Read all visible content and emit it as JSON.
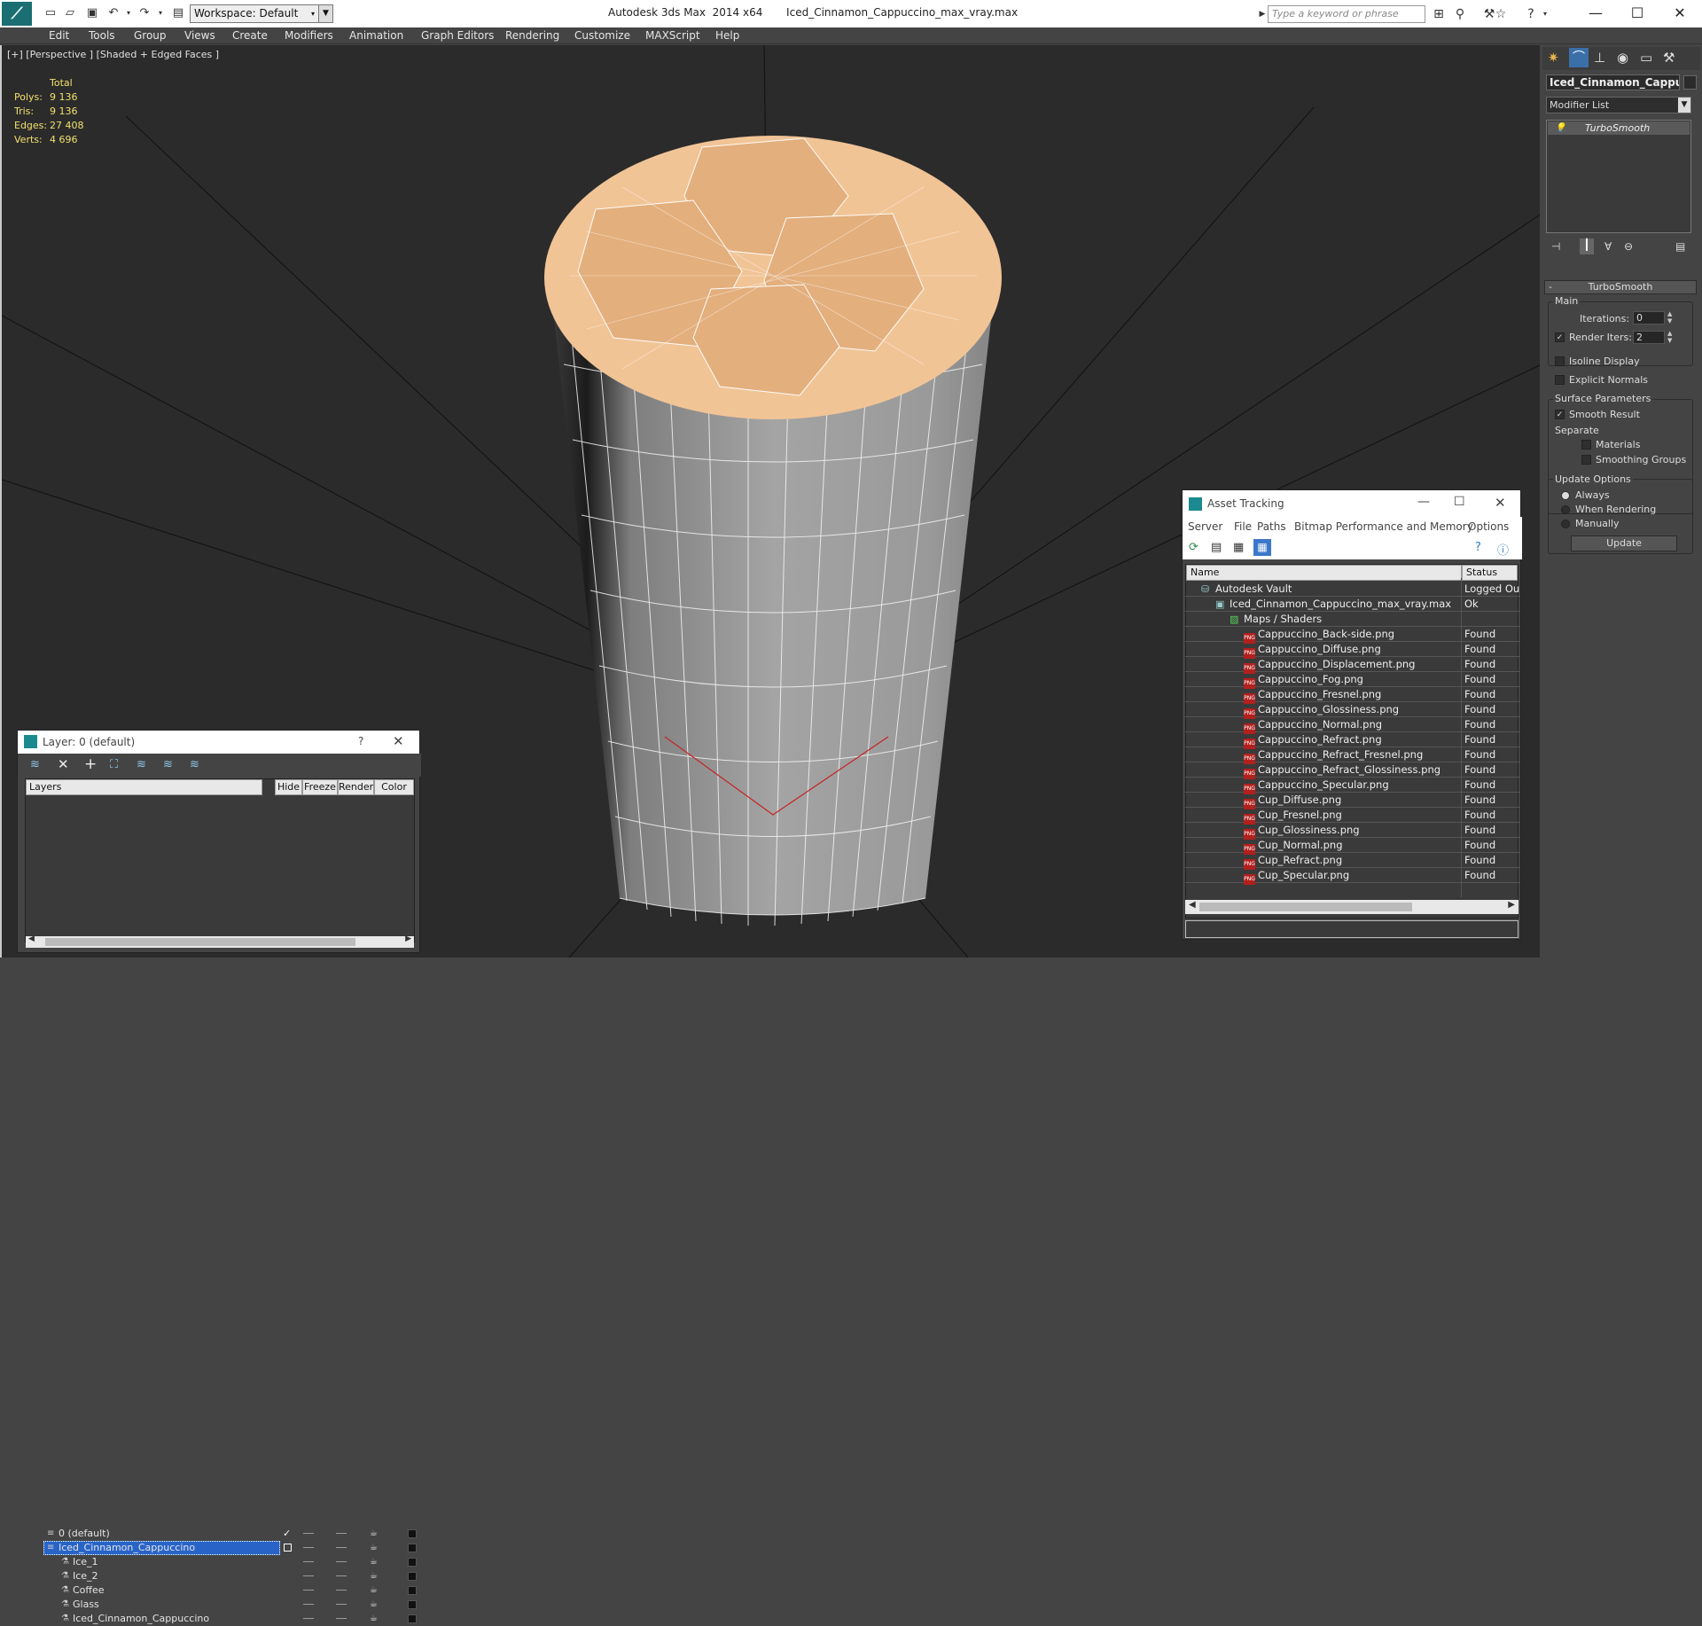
{
  "window": {
    "title": "Autodesk 3ds Max  2014 x64       Iced_Cinnamon_Cappuccino_max_vray.max",
    "workspace": "Workspace: Default",
    "search_placeholder": "Type a keyword or phrase"
  },
  "menu": [
    "Edit",
    "Tools",
    "Group",
    "Views",
    "Create",
    "Modifiers",
    "Animation",
    "Graph Editors",
    "Rendering",
    "Customize",
    "MAXScript",
    "Help"
  ],
  "viewport": {
    "label": "[+] [Perspective ] [Shaded + Edged Faces ]",
    "stats": {
      "header": "Total",
      "rows": [
        {
          "k": "Polys:",
          "v": "9 136"
        },
        {
          "k": "Tris:",
          "v": "9 136"
        },
        {
          "k": "Edges:",
          "v": "27 408"
        },
        {
          "k": "Verts:",
          "v": "4 696"
        }
      ]
    },
    "colors": {
      "background": "#2b2b2b",
      "grid": "#141414",
      "cup": "#9a9a9a",
      "coffee": "#f1c496",
      "wire": "#ffffff"
    }
  },
  "layer_panel": {
    "title": "Layer: 0 (default)",
    "help": "?",
    "columns": [
      "Layers",
      "Hide",
      "Freeze",
      "Render",
      "Color"
    ],
    "rows": [
      {
        "name": "0 (default)",
        "indent": 1,
        "selected": false,
        "active": true,
        "color": "#111111"
      },
      {
        "name": "Iced_Cinnamon_Cappuccino",
        "indent": 1,
        "selected": true,
        "active": false,
        "color": "#111111"
      },
      {
        "name": "Ice_1",
        "indent": 2,
        "selected": false,
        "active": false,
        "color": "#111111"
      },
      {
        "name": "Ice_2",
        "indent": 2,
        "selected": false,
        "active": false,
        "color": "#111111"
      },
      {
        "name": "Coffee",
        "indent": 2,
        "selected": false,
        "active": false,
        "color": "#111111"
      },
      {
        "name": "Glass",
        "indent": 2,
        "selected": false,
        "active": false,
        "color": "#111111"
      },
      {
        "name": "Iced_Cinnamon_Cappuccino",
        "indent": 2,
        "selected": false,
        "active": false,
        "color": "#111111"
      }
    ]
  },
  "asset_panel": {
    "title": "Asset Tracking",
    "menu": [
      "Server",
      "File",
      "Paths",
      "Bitmap Performance and Memory",
      "Options"
    ],
    "columns": [
      "Name",
      "Status"
    ],
    "vault": {
      "name": "Autodesk Vault",
      "status": "Logged Ou"
    },
    "file": {
      "name": "Iced_Cinnamon_Cappuccino_max_vray.max",
      "status": "Ok"
    },
    "maps_label": "Maps / Shaders",
    "png_tag": "PNG",
    "maps": [
      {
        "name": "Cappuccino_Back-side.png",
        "status": "Found"
      },
      {
        "name": "Cappuccino_Diffuse.png",
        "status": "Found"
      },
      {
        "name": "Cappuccino_Displacement.png",
        "status": "Found"
      },
      {
        "name": "Cappuccino_Fog.png",
        "status": "Found"
      },
      {
        "name": "Cappuccino_Fresnel.png",
        "status": "Found"
      },
      {
        "name": "Cappuccino_Glossiness.png",
        "status": "Found"
      },
      {
        "name": "Cappuccino_Normal.png",
        "status": "Found"
      },
      {
        "name": "Cappuccino_Refract.png",
        "status": "Found"
      },
      {
        "name": "Cappuccino_Refract_Fresnel.png",
        "status": "Found"
      },
      {
        "name": "Cappuccino_Refract_Glossiness.png",
        "status": "Found"
      },
      {
        "name": "Cappuccino_Specular.png",
        "status": "Found"
      },
      {
        "name": "Cup_Diffuse.png",
        "status": "Found"
      },
      {
        "name": "Cup_Fresnel.png",
        "status": "Found"
      },
      {
        "name": "Cup_Glossiness.png",
        "status": "Found"
      },
      {
        "name": "Cup_Normal.png",
        "status": "Found"
      },
      {
        "name": "Cup_Refract.png",
        "status": "Found"
      },
      {
        "name": "Cup_Specular.png",
        "status": "Found"
      }
    ]
  },
  "command_panel": {
    "object_name": "Iced_Cinnamon_Cappucc",
    "modifier_list": "Modifier List",
    "stack_item": "TurboSmooth",
    "rollout_title": "TurboSmooth",
    "main_label": "Main",
    "iterations_label": "Iterations:",
    "iterations_value": "0",
    "render_iters_label": "Render Iters:",
    "render_iters_value": "2",
    "render_iters_checked": true,
    "isoline_label": "Isoline Display",
    "explicit_label": "Explicit Normals",
    "surface_label": "Surface Parameters",
    "smooth_label": "Smooth Result",
    "separate_label": "Separate",
    "materials_label": "Materials",
    "smoothing_label": "Smoothing Groups",
    "update_label": "Update Options",
    "always_label": "Always",
    "when_label": "When Rendering",
    "manually_label": "Manually",
    "update_button": "Update",
    "collapse": "-"
  }
}
